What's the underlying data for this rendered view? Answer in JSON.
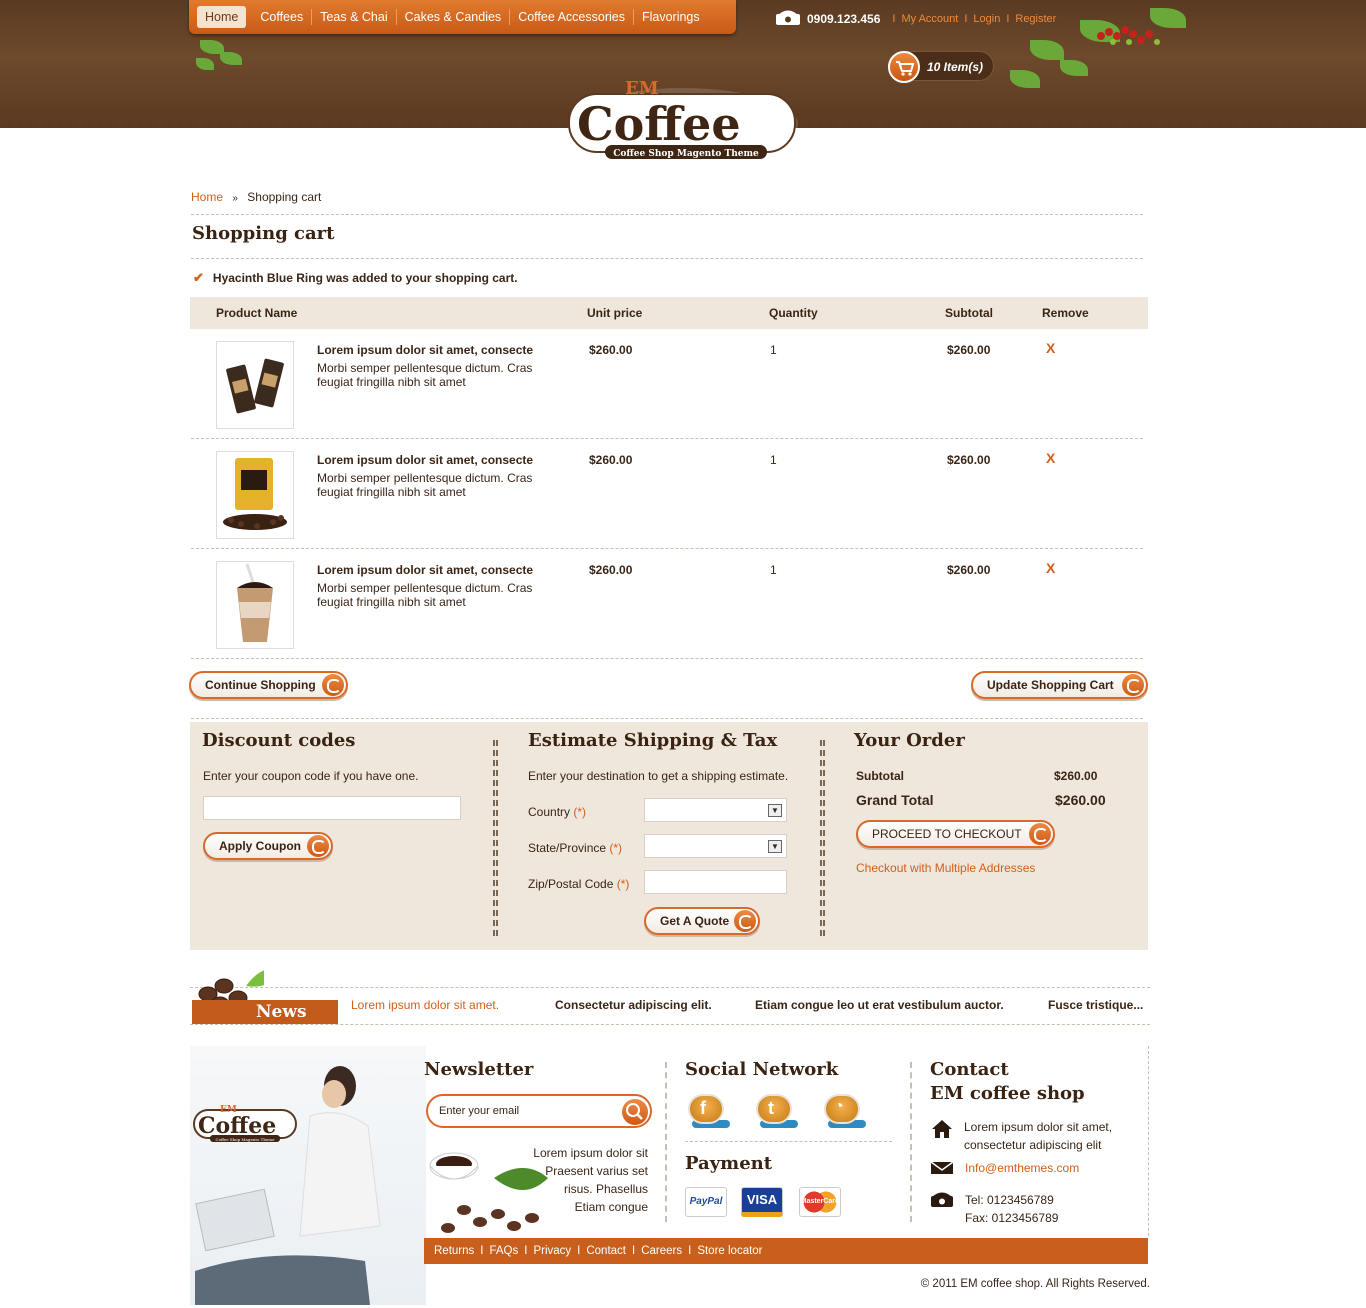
{
  "nav": {
    "items": [
      "Home",
      "Coffees",
      "Teas & Chai",
      "Cakes & Candies",
      "Coffee Accessories",
      "Flavorings"
    ]
  },
  "topbar": {
    "phone": "0909.123.456",
    "my_account": "My Account",
    "login": "Login",
    "register": "Register",
    "sep": "I"
  },
  "cart": {
    "count_label": "10 Item(s)"
  },
  "logo": {
    "em": "EM",
    "name": "Coffee",
    "tagline": "Coffee Shop Magento Theme"
  },
  "breadcrumb": {
    "home": "Home",
    "sep": "»",
    "current": "Shopping cart"
  },
  "page_title": "Shopping cart",
  "success_message": "Hyacinth Blue Ring was added to your shopping cart.",
  "table": {
    "headers": {
      "product": "Product Name",
      "price": "Unit price",
      "qty": "Quantity",
      "subtotal": "Subtotal",
      "remove": "Remove"
    },
    "rows": [
      {
        "name": "Lorem ipsum dolor sit amet, consecte",
        "desc": "Morbi semper pellentesque dictum. Cras feugiat fringilla nibh sit amet",
        "price": "$260.00",
        "qty": "1",
        "subtotal": "$260.00",
        "remove": "X"
      },
      {
        "name": "Lorem ipsum dolor sit amet, consecte",
        "desc": "Morbi semper pellentesque dictum. Cras feugiat fringilla nibh sit amet",
        "price": "$260.00",
        "qty": "1",
        "subtotal": "$260.00",
        "remove": "X"
      },
      {
        "name": "Lorem ipsum dolor sit amet, consecte",
        "desc": "Morbi semper pellentesque dictum. Cras feugiat fringilla nibh sit amet",
        "price": "$260.00",
        "qty": "1",
        "subtotal": "$260.00",
        "remove": "X"
      }
    ]
  },
  "buttons": {
    "continue": "Continue Shopping",
    "update": "Update Shopping Cart",
    "apply_coupon": "Apply Coupon",
    "get_quote": "Get A Quote",
    "checkout": "PROCEED TO CHECKOUT"
  },
  "discount": {
    "title": "Discount codes",
    "text": "Enter your coupon code if you have one.",
    "value": ""
  },
  "shipping": {
    "title": "Estimate Shipping & Tax",
    "text": "Enter your destination to get a shipping estimate.",
    "country_label": "Country",
    "state_label": "State/Province",
    "zip_label": "Zip/Postal Code",
    "required_mark": "(*)"
  },
  "order": {
    "title": "Your Order",
    "subtotal_label": "Subtotal",
    "subtotal_value": "$260.00",
    "grand_label": "Grand Total",
    "grand_value": "$260.00",
    "multi_link": "Checkout with Multiple Addresses"
  },
  "news": {
    "label": "News",
    "items": [
      "Lorem ipsum dolor sit amet.",
      "Consectetur adipiscing elit.",
      "Etiam congue leo ut erat vestibulum auctor.",
      "Fusce tristique..."
    ]
  },
  "footer": {
    "newsletter_title": "Newsletter",
    "newsletter_placeholder": "Enter your email",
    "newsletter_text": [
      "Lorem ipsum dolor sit",
      "Praesent varius set",
      "risus. Phasellus",
      "Etiam congue"
    ],
    "social_title": "Social Network",
    "payment_title": "Payment",
    "payment": [
      "PayPal",
      "VISA",
      "MasterCard"
    ],
    "contact_title_1": "Contact",
    "contact_title_2": "EM coffee shop",
    "address": [
      "Lorem ipsum dolor sit amet,",
      "consectetur adipiscing elit"
    ],
    "email": "Info@emthemes.com",
    "tel": "Tel: 0123456789",
    "fax": "Fax: 0123456789",
    "links": [
      "Returns",
      "FAQs",
      "Privacy",
      "Contact",
      "Careers",
      "Store locator"
    ],
    "copyright": "© 2011 EM coffee shop. All Rights Reserved."
  },
  "colors": {
    "accent": "#d25f1a",
    "header_brown": "#5a3a22",
    "panel_bg": "#efe6dc"
  }
}
